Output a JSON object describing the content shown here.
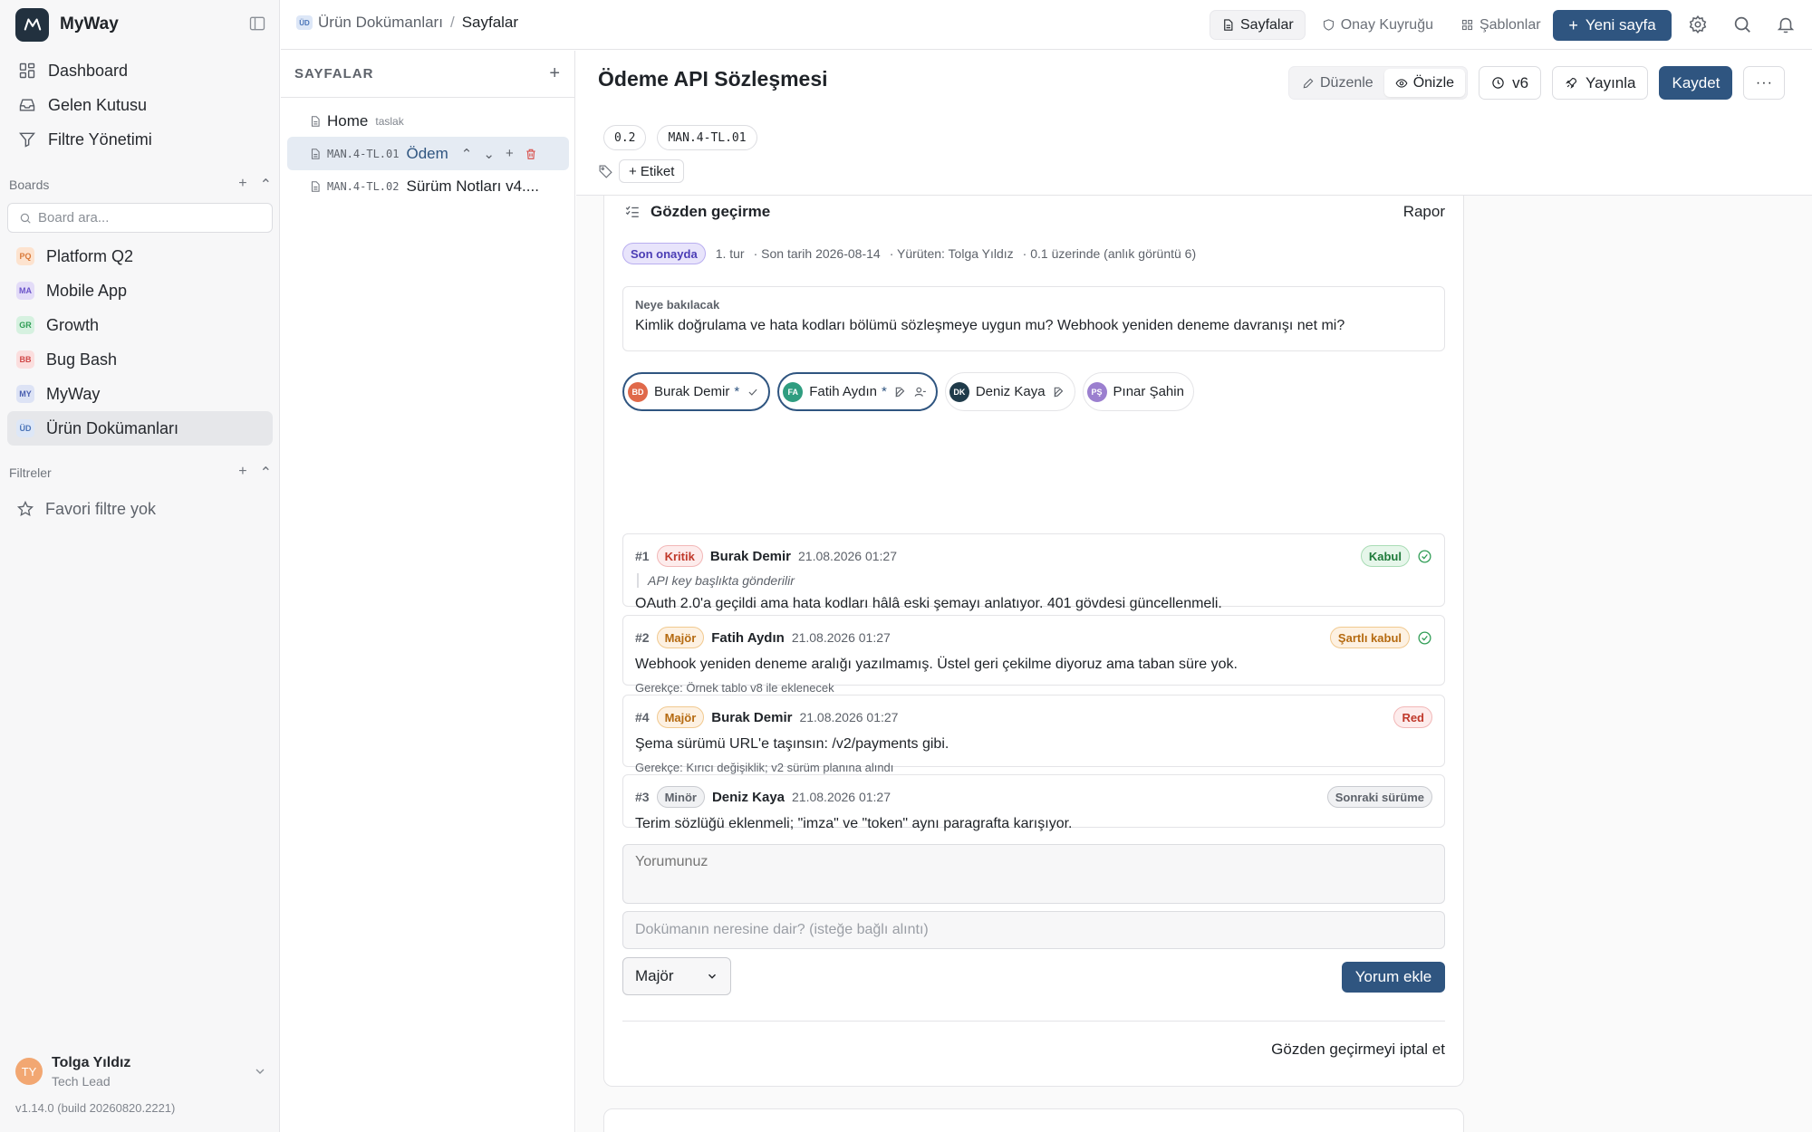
{
  "app": {
    "name": "MyWay"
  },
  "sidebar": {
    "nav": [
      {
        "label": "Dashboard",
        "icon": "grid-icon"
      },
      {
        "label": "Gelen Kutusu",
        "icon": "inbox-icon"
      },
      {
        "label": "Filtre Yönetimi",
        "icon": "filter-icon"
      }
    ],
    "boards_title": "Boards",
    "board_search_placeholder": "Board ara...",
    "boards": [
      {
        "abbr": "PQ",
        "label": "Platform Q2",
        "bg": "#fde3cf",
        "fg": "#d97a3a"
      },
      {
        "abbr": "MA",
        "label": "Mobile App",
        "bg": "#e3dcf8",
        "fg": "#6b54c9"
      },
      {
        "abbr": "GR",
        "label": "Growth",
        "bg": "#d6f1e0",
        "fg": "#2f9d55"
      },
      {
        "abbr": "BB",
        "label": "Bug Bash",
        "bg": "#fbdede",
        "fg": "#d04949"
      },
      {
        "abbr": "MY",
        "label": "MyWay",
        "bg": "#dde3f5",
        "fg": "#4a5fb0"
      },
      {
        "abbr": "ÜD",
        "label": "Ürün Dokümanları",
        "bg": "#dde7f7",
        "fg": "#4a74b8",
        "active": true
      }
    ],
    "filters_title": "Filtreler",
    "filters_empty": "Favori filtre yok",
    "user": {
      "initials": "TY",
      "name": "Tolga Yıldız",
      "role": "Tech Lead"
    },
    "version": "v1.14.0 (build 20260820.2221)"
  },
  "topbar": {
    "breadcrumb": {
      "space_badge": "ÜD",
      "space": "Ürün Dokümanları",
      "separator": "/",
      "current": "Sayfalar"
    },
    "tabs": [
      {
        "label": "Sayfalar",
        "icon": "file-icon",
        "active": true
      },
      {
        "label": "Onay Kuyruğu",
        "icon": "shield-icon"
      },
      {
        "label": "Şablonlar",
        "icon": "template-grid-icon"
      }
    ],
    "new_page": {
      "plus": "+",
      "label": "Yeni sayfa"
    }
  },
  "pages": {
    "title": "SAYFALAR",
    "add": "+",
    "items": [
      {
        "code": "",
        "title": "Home",
        "suffix": "taslak"
      },
      {
        "code": "MAN.4-TL.01",
        "title": "Ödem",
        "active": true
      },
      {
        "code": "MAN.4-TL.02",
        "title": "Sürüm Notları v4...."
      }
    ],
    "row_actions": {
      "up": "⌃",
      "down": "⌄",
      "add": "+"
    }
  },
  "doc": {
    "title": "Ödeme API Sözleşmesi",
    "mode_edit": "Düzenle",
    "mode_preview": "Önizle",
    "version": "v6",
    "publish": "Yayınla",
    "save": "Kaydet",
    "more": "···",
    "chips": [
      "0.2",
      "MAN.4-TL.01"
    ],
    "tag_button": "+ Etiket"
  },
  "review": {
    "title": "Gözden geçirme",
    "report": "Rapor",
    "status": "Son onayda",
    "meta": [
      "1. tur",
      "· Son tarih 2026-08-14",
      "· Yürüten: Tolga Yıldız",
      "· 0.1 üzerinde (anlık görüntü 6)"
    ],
    "focus_label": "Neye bakılacak",
    "focus_text": "Kimlik doğrulama ve hata kodları bölümü sözleşmeye uygun mu? Webhook yeniden deneme davranışı net mi?",
    "reviewers": [
      {
        "initials": "BD",
        "name": "Burak Demir",
        "star": "*",
        "color": "#e0694a",
        "icon": "check-icon",
        "selected": true
      },
      {
        "initials": "FA",
        "name": "Fatih Aydın",
        "star": "*",
        "color": "#2f9d80",
        "icon": "edit-icon",
        "icon2": "user-minus-icon",
        "selected": true
      },
      {
        "initials": "DK",
        "name": "Deniz Kaya",
        "star": "",
        "color": "#1f3b4a",
        "icon": "edit-icon"
      },
      {
        "initials": "PŞ",
        "name": "Pınar Şahin",
        "star": "",
        "color": "#9b7fcf",
        "icon": ""
      }
    ],
    "comments": [
      {
        "num": "#1",
        "severity": "Kritik",
        "sev_class": "kritik",
        "author": "Burak Demir",
        "date": "21.08.2026 01:27",
        "resolution": "Kabul",
        "res_class": "kabul",
        "check": true,
        "quote": "API key başlıkta gönderilir",
        "body": "OAuth 2.0'a geçildi ama hata kodları hâlâ eski şemayı anlatıyor. 401 gövdesi güncellenmeli.",
        "reason": ""
      },
      {
        "num": "#2",
        "severity": "Majör",
        "sev_class": "major",
        "author": "Fatih Aydın",
        "date": "21.08.2026 01:27",
        "resolution": "Şartlı kabul",
        "res_class": "sartli",
        "check": true,
        "quote": "",
        "body": "Webhook yeniden deneme aralığı yazılmamış. Üstel geri çekilme diyoruz ama taban süre yok.",
        "reason": "Gerekçe: Örnek tablo v8 ile eklenecek"
      },
      {
        "num": "#4",
        "severity": "Majör",
        "sev_class": "major",
        "author": "Burak Demir",
        "date": "21.08.2026 01:27",
        "resolution": "Red",
        "res_class": "red",
        "check": false,
        "quote": "",
        "body": "Şema sürümü URL'e taşınsın: /v2/payments gibi.",
        "reason": "Gerekçe: Kırıcı değişiklik; v2 sürüm planına alındı"
      },
      {
        "num": "#3",
        "severity": "Minör",
        "sev_class": "minor",
        "author": "Deniz Kaya",
        "date": "21.08.2026 01:27",
        "resolution": "Sonraki sürüme",
        "res_class": "sonraki",
        "check": false,
        "quote": "",
        "body": "Terim sözlüğü eklenmeli; \"imza\" ve \"token\" aynı paragrafta karışıyor.",
        "reason": ""
      }
    ],
    "comment_placeholder": "Yorumunuz",
    "quote_placeholder": "Dokümanın neresine dair? (isteğe bağlı alıntı)",
    "severity_selected": "Majör",
    "add_comment": "Yorum ekle",
    "cancel": "Gözden geçirmeyi iptal et"
  }
}
